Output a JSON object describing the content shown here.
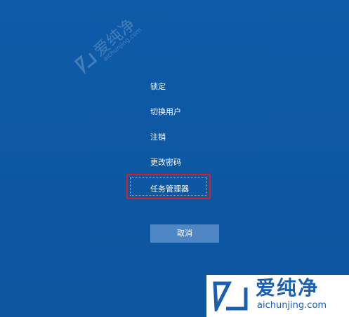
{
  "menu": {
    "items": [
      {
        "label": "锁定"
      },
      {
        "label": "切换用户"
      },
      {
        "label": "注销"
      },
      {
        "label": "更改密码"
      },
      {
        "label": "任务管理器"
      }
    ]
  },
  "cancel_button": {
    "label": "取消"
  },
  "watermark": {
    "title": "爱纯净",
    "url": "aichunjing.com"
  },
  "colors": {
    "background": "#0f59a8",
    "highlight_border": "#d0202a",
    "button": "#4f87c4",
    "watermark_blue": "#1b5fb0"
  }
}
